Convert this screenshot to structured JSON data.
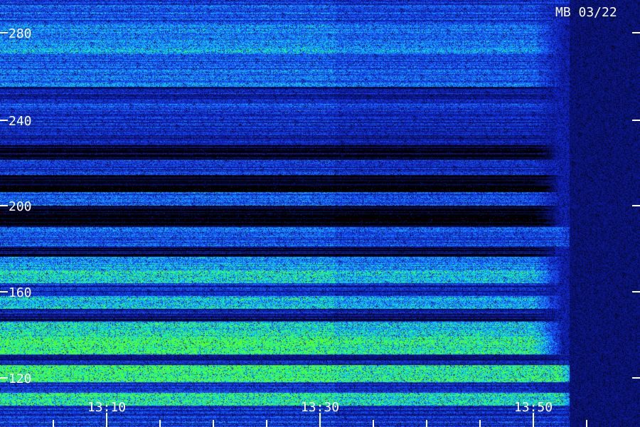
{
  "chart_data": {
    "type": "heatmap",
    "title": "MB 03/22",
    "x_tick_labels": [
      "13:10",
      "13:30",
      "13:50"
    ],
    "x_range_minutes": [
      "13:00",
      "13:58"
    ],
    "y_tick_labels": [
      "280",
      "240",
      "200",
      "160",
      "120"
    ],
    "y_ticks": [
      280,
      240,
      200,
      160,
      120
    ],
    "ylim": [
      107,
      293
    ],
    "colormap": [
      "#000000",
      "#1020c0",
      "#1a66ff",
      "#14c8ff",
      "#18ff88",
      "#60ff20"
    ],
    "bands": [
      {
        "y_from": 286,
        "y_to": 293,
        "intensity": 0.35,
        "end": "13:50"
      },
      {
        "y_from": 276,
        "y_to": 285,
        "intensity": 0.45,
        "end": "13:50"
      },
      {
        "y_from": 270,
        "y_to": 276,
        "intensity": 0.55,
        "end": "13:50"
      },
      {
        "y_from": 263,
        "y_to": 270,
        "intensity": 0.35,
        "end": "13:50"
      },
      {
        "y_from": 255,
        "y_to": 263,
        "intensity": 0.42,
        "end": "13:50"
      },
      {
        "y_from": 249,
        "y_to": 255,
        "intensity": 0.18,
        "end": "13:50"
      },
      {
        "y_from": 241,
        "y_to": 249,
        "intensity": 0.3,
        "end": "13:50"
      },
      {
        "y_from": 236,
        "y_to": 241,
        "intensity": 0.25,
        "end": "13:50"
      },
      {
        "y_from": 228,
        "y_to": 236,
        "intensity": 0.22,
        "end": "13:50"
      },
      {
        "y_from": 221,
        "y_to": 228,
        "intensity": 0.02,
        "end": "13:50"
      },
      {
        "y_from": 214,
        "y_to": 221,
        "intensity": 0.25,
        "end": "13:50"
      },
      {
        "y_from": 206,
        "y_to": 214,
        "intensity": 0.0,
        "end": "13:50"
      },
      {
        "y_from": 200,
        "y_to": 206,
        "intensity": 0.38,
        "end": "13:50"
      },
      {
        "y_from": 190,
        "y_to": 200,
        "intensity": 0.0,
        "end": "13:50"
      },
      {
        "y_from": 181,
        "y_to": 190,
        "intensity": 0.35,
        "end": "13:52"
      },
      {
        "y_from": 176,
        "y_to": 181,
        "intensity": 0.1,
        "end": "13:50"
      },
      {
        "y_from": 170,
        "y_to": 176,
        "intensity": 0.55,
        "end": "13:50"
      },
      {
        "y_from": 164,
        "y_to": 170,
        "intensity": 0.72,
        "end": "13:50"
      },
      {
        "y_from": 158,
        "y_to": 164,
        "intensity": 0.25,
        "end": "13:50"
      },
      {
        "y_from": 152,
        "y_to": 158,
        "intensity": 0.6,
        "end": "13:50"
      },
      {
        "y_from": 146,
        "y_to": 152,
        "intensity": 0.15,
        "end": "13:50"
      },
      {
        "y_from": 139,
        "y_to": 146,
        "intensity": 0.7,
        "end": "13:50"
      },
      {
        "y_from": 131,
        "y_to": 139,
        "intensity": 0.92,
        "end": "13:50"
      },
      {
        "y_from": 126,
        "y_to": 131,
        "intensity": 0.2,
        "end": "13:52"
      },
      {
        "y_from": 118,
        "y_to": 126,
        "intensity": 0.9,
        "end": "13:52"
      },
      {
        "y_from": 113,
        "y_to": 118,
        "intensity": 0.25,
        "end": "13:50"
      },
      {
        "y_from": 107,
        "y_to": 113,
        "intensity": 0.8,
        "end": "13:52"
      }
    ]
  }
}
